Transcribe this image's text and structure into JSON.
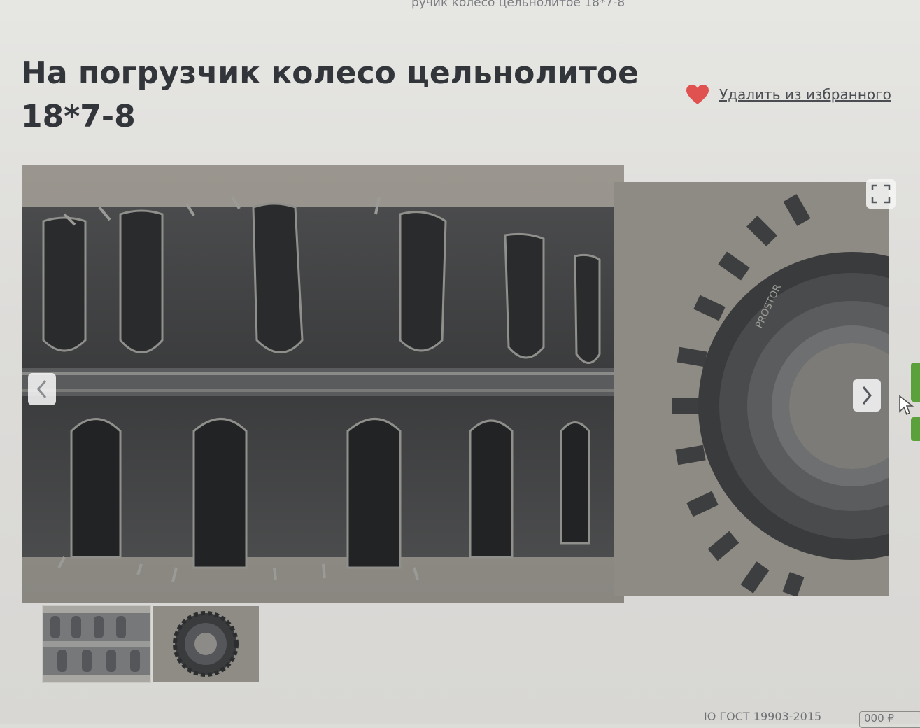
{
  "breadcrumb": "ручик колесо цельнолитое 18*7-8",
  "title": "На погрузчик колесо цельнолитое 18*7-8",
  "favorite": {
    "label": "Удалить из избранного",
    "icon": "heart-icon",
    "color": "#e0524f"
  },
  "gallery": {
    "main_photo": "tire-tread-closeup",
    "side_photo": "tire-side-view",
    "side_photo_text": "PROSTOR",
    "prev_icon": "chevron-left-icon",
    "next_icon": "chevron-right-icon",
    "expand_icon": "expand-icon",
    "thumbnails": [
      "tire-tread-thumbnail",
      "tire-side-thumbnail"
    ]
  },
  "bottom": {
    "text": "ІО ГОСТ 19903-2015",
    "box_text": "000 ₽"
  },
  "colors": {
    "accent_green": "#5aa13c",
    "heart": "#e0524f",
    "background": "#dcdcd9"
  }
}
